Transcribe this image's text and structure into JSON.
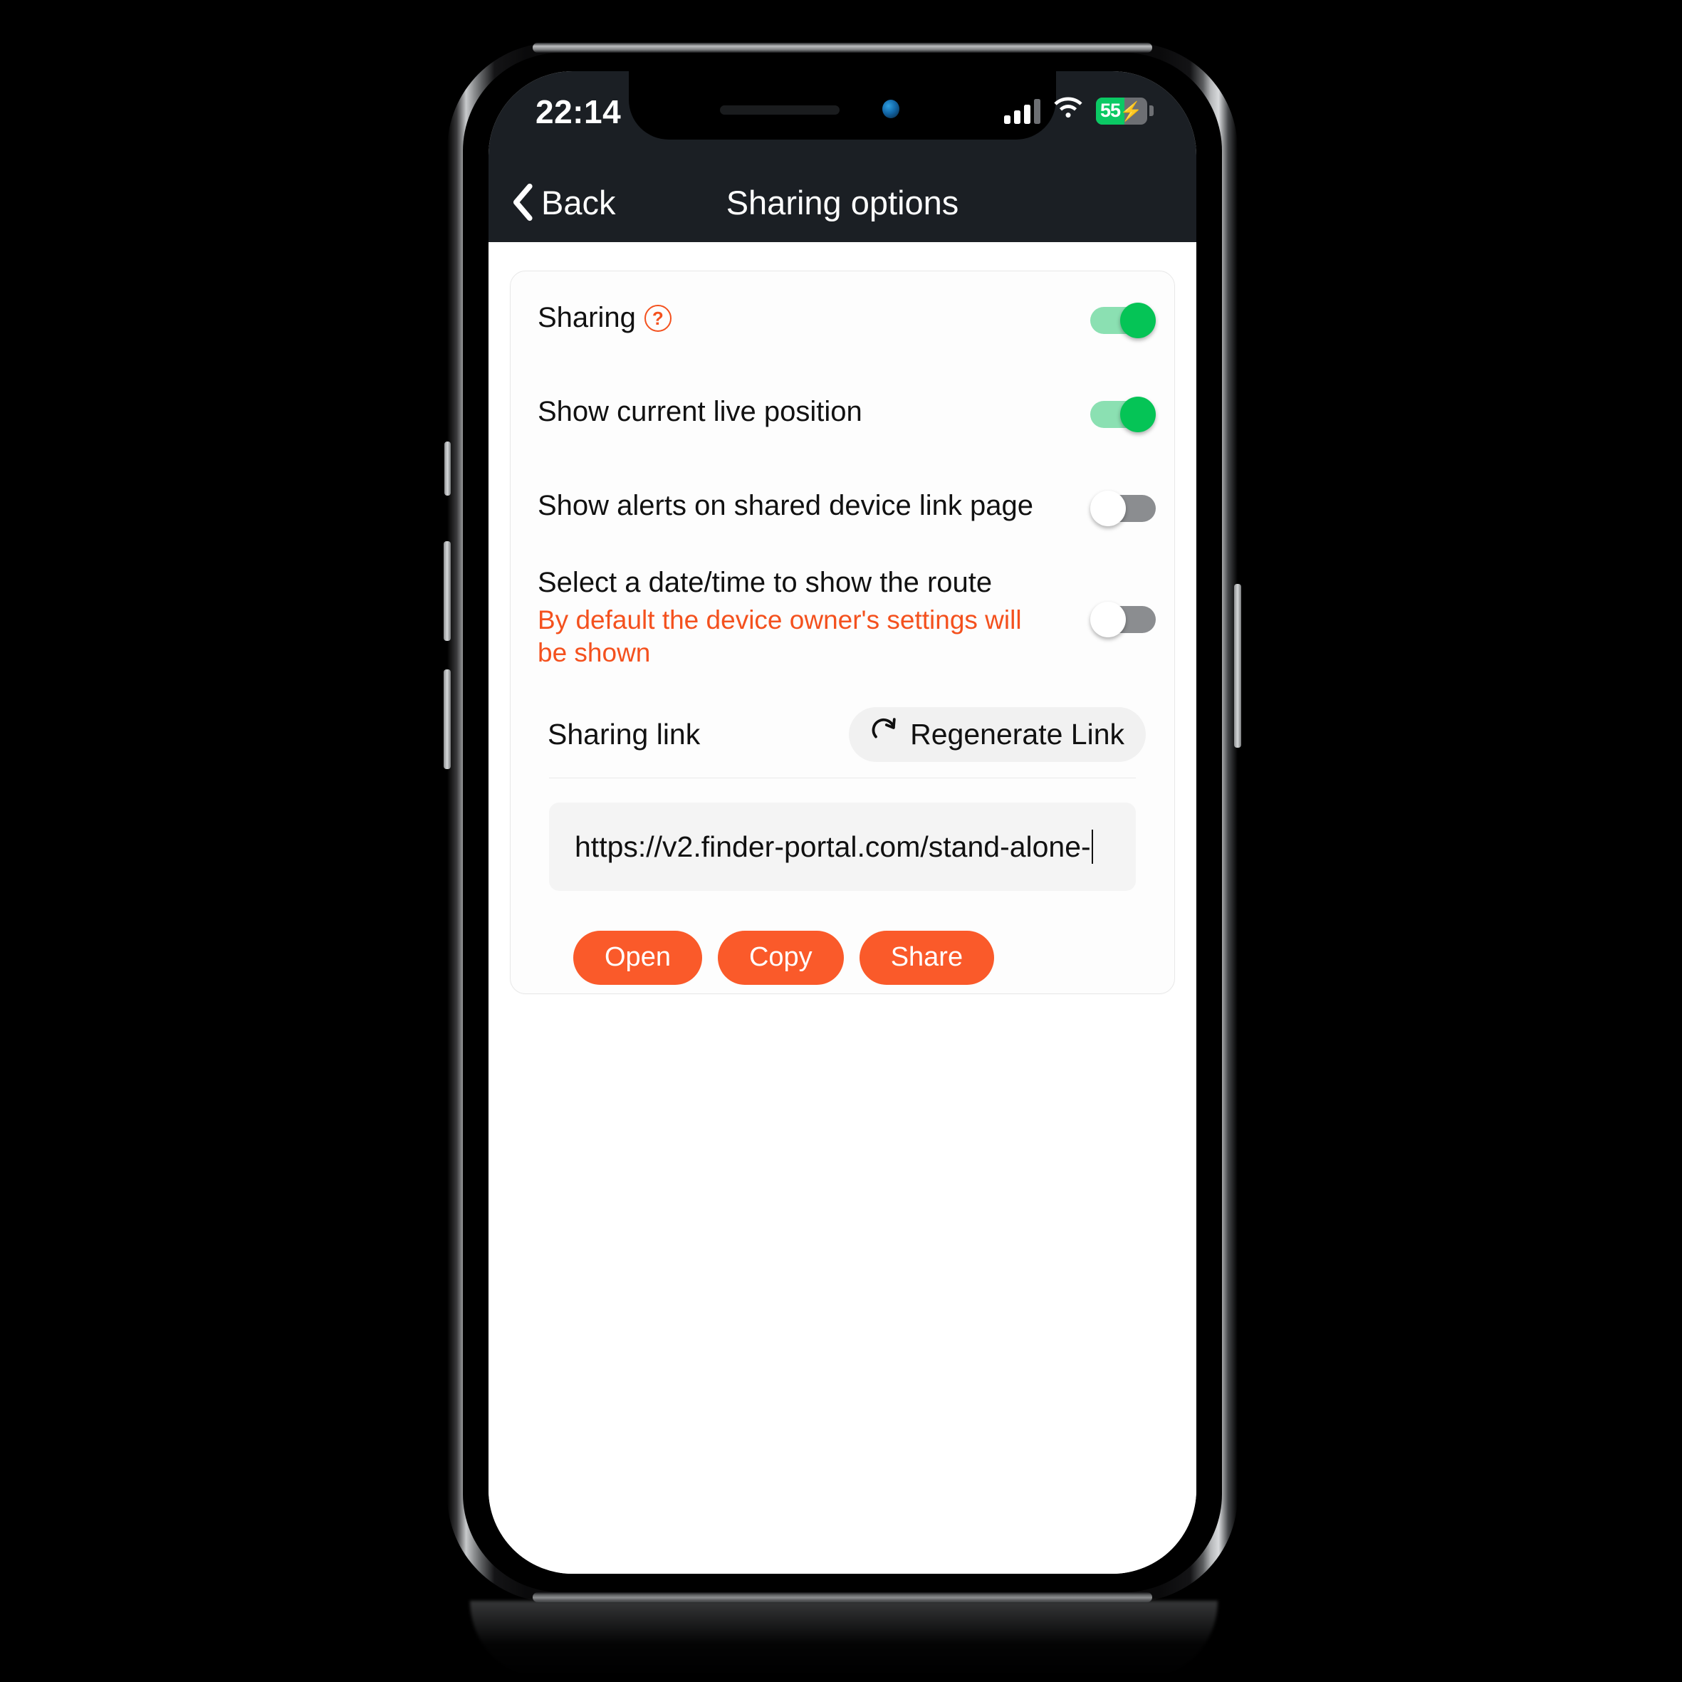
{
  "status_bar": {
    "time": "22:14",
    "cellular_icon": "cellular-signal-icon",
    "wifi_icon": "wifi-icon",
    "battery_percent": "55",
    "battery_charging_glyph": "⚡",
    "battery_fill_color": "#0bc964"
  },
  "nav": {
    "back_label": "Back",
    "back_icon": "chevron-left-icon",
    "title": "Sharing options"
  },
  "settings": {
    "rows": [
      {
        "title": "Sharing",
        "has_help_icon": true,
        "help_glyph": "?",
        "subtitle": "",
        "toggle_state": "on"
      },
      {
        "title": "Show current live position",
        "has_help_icon": false,
        "help_glyph": "",
        "subtitle": "",
        "toggle_state": "on"
      },
      {
        "title": "Show alerts on shared device link page",
        "has_help_icon": false,
        "help_glyph": "",
        "subtitle": "",
        "toggle_state": "off"
      },
      {
        "title": "Select a date/time to show the route",
        "has_help_icon": false,
        "help_glyph": "",
        "subtitle": "By default the device owner's settings will be shown",
        "toggle_state": "off"
      }
    ]
  },
  "sharing_link": {
    "section_label": "Sharing link",
    "regenerate_label": "Regenerate Link",
    "regenerate_icon": "refresh-icon",
    "url_value": "https://v2.finder-portal.com/stand-alone-",
    "url_placeholder": "Sharing link",
    "actions": [
      {
        "label": "Open"
      },
      {
        "label": "Copy"
      },
      {
        "label": "Share"
      }
    ]
  },
  "colors": {
    "accent_orange": "#fa5a2a",
    "toggle_on_green": "#05c456",
    "toggle_on_track": "#8be0b2",
    "toggle_off_track": "#8b8d90",
    "navbar_dark": "#1b1f24",
    "help_icon_orange": "#f4511e",
    "subtitle_orange": "#f4511e"
  }
}
